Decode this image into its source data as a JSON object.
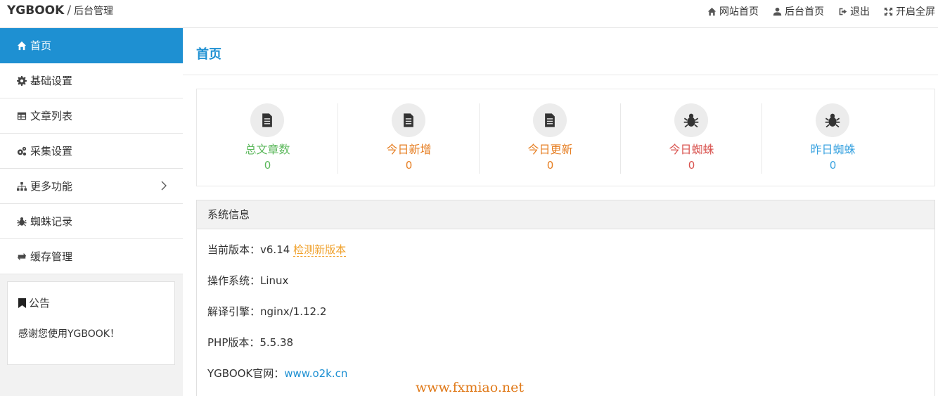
{
  "header": {
    "brand": "YGBOOK",
    "separator": "/",
    "subtitle": "后台管理",
    "nav": [
      {
        "label": "网站首页",
        "icon": "home-icon"
      },
      {
        "label": "后台首页",
        "icon": "user-icon"
      },
      {
        "label": "退出",
        "icon": "sign-out-icon"
      },
      {
        "label": "开启全屏",
        "icon": "fullscreen-icon"
      }
    ]
  },
  "sidebar": {
    "items": [
      {
        "label": "首页",
        "icon": "home-icon",
        "active": true
      },
      {
        "label": "基础设置",
        "icon": "gear-icon"
      },
      {
        "label": "文章列表",
        "icon": "table-icon"
      },
      {
        "label": "采集设置",
        "icon": "gears-icon"
      },
      {
        "label": "更多功能",
        "icon": "sitemap-icon",
        "has_submenu": true
      },
      {
        "label": "蜘蛛记录",
        "icon": "bug-icon"
      },
      {
        "label": "缓存管理",
        "icon": "refresh-icon"
      }
    ],
    "notice": {
      "title": "公告",
      "icon": "bookmark-icon",
      "body": "感谢您使用YGBOOK！"
    }
  },
  "main": {
    "title": "首页",
    "stats": [
      {
        "label": "总文章数",
        "value": "0",
        "icon": "file-icon",
        "color": "#5cb85c"
      },
      {
        "label": "今日新增",
        "value": "0",
        "icon": "file-icon",
        "color": "#e67e22"
      },
      {
        "label": "今日更新",
        "value": "0",
        "icon": "file-icon",
        "color": "#e67e22"
      },
      {
        "label": "今日蜘蛛",
        "value": "0",
        "icon": "bug-icon",
        "color": "#d9534f"
      },
      {
        "label": "昨日蜘蛛",
        "value": "0",
        "icon": "bug-icon",
        "color": "#3aa3e0"
      }
    ],
    "sysinfo": {
      "title": "系统信息",
      "version_label": "当前版本：",
      "version": "v6.14",
      "check_update": "检测新版本",
      "os_label": "操作系统：",
      "os": "Linux",
      "engine_label": "解译引擎：",
      "engine": "nginx/1.12.2",
      "php_label": "PHP版本：",
      "php": "5.5.38",
      "site_label": "YGBOOK官网：",
      "site": "www.o2k.cn"
    }
  },
  "watermark": "www.fxmiao.net"
}
